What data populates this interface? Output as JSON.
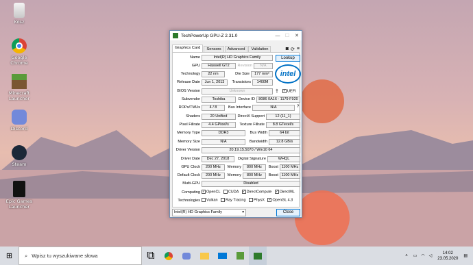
{
  "desktop_icons": [
    {
      "label": "Kosz",
      "icon": "recycle-bin-icon"
    },
    {
      "label": "Google Chrome",
      "icon": "chrome-icon"
    },
    {
      "label": "Minecraft Launcher",
      "icon": "minecraft-icon"
    },
    {
      "label": "Discord",
      "icon": "discord-icon"
    },
    {
      "label": "Steam",
      "icon": "steam-icon"
    },
    {
      "label": "Epic Games Launcher",
      "icon": "epic-games-icon"
    }
  ],
  "window": {
    "title": "TechPowerUp GPU-Z 2.31.0",
    "tabs": [
      "Graphics Card",
      "Sensors",
      "Advanced",
      "Validation"
    ],
    "lookup": "Lookup",
    "close": "Close",
    "gpu_select": "Intel(R) HD Graphics Family",
    "logo": "intel",
    "fields": {
      "name_l": "Name",
      "name": "Intel(R) HD Graphics Family",
      "gpu_l": "GPU",
      "gpu": "Haswell GT2",
      "rev_l": "Revision",
      "rev": "N/A",
      "tech_l": "Technology",
      "tech": "22 nm",
      "die_l": "Die Size",
      "die": "177 mm²",
      "rel_l": "Release Date",
      "rel": "Jun 1, 2013",
      "trans_l": "Transistors",
      "trans": "1400M",
      "bios_l": "BIOS Version",
      "bios": "Unknown",
      "uefi": "UEFI",
      "sub_l": "Subvendor",
      "sub": "Toshiba",
      "dev_l": "Device ID",
      "dev": "8086 0A16 - 1179 F920",
      "rops_l": "ROPs/TMUs",
      "rops": "4 / 8",
      "bus_l": "Bus Interface",
      "bus": "N/A",
      "q": "?",
      "shad_l": "Shaders",
      "shad": "20 Unified",
      "dx_l": "DirectX Support",
      "dx": "12 (11_1)",
      "pix_l": "Pixel Fillrate",
      "pix": "4.4 GPixel/s",
      "tex_l": "Texture Fillrate",
      "tex": "8.8 GTexel/s",
      "mt_l": "Memory Type",
      "mt": "DDR3",
      "bw_l": "Bus Width",
      "bw": "64 bit",
      "ms_l": "Memory Size",
      "ms": "N/A",
      "band_l": "Bandwidth",
      "band": "12.8 GB/s",
      "drv_l": "Driver Version",
      "drv": "20.19.15.5070 / Win10 64",
      "dd_l": "Driver Date",
      "dd": "Dec 27, 2018",
      "sig_l": "Digital Signature",
      "sig": "WHQL",
      "gc_l": "GPU Clock",
      "gc": "200 MHz",
      "mem1_l": "Memory",
      "mem1": "800 MHz",
      "boost1_l": "Boost",
      "boost1": "1100 MHz",
      "dc_l": "Default Clock",
      "dc": "200 MHz",
      "mem2_l": "Memory",
      "mem2": "800 MHz",
      "boost2_l": "Boost",
      "boost2": "1100 MHz",
      "mg_l": "Multi-GPU",
      "mg": "Disabled",
      "comp_l": "Computing",
      "opencl": "OpenCL",
      "cuda": "CUDA",
      "dcomp": "DirectCompute",
      "dml": "DirectML",
      "techs_l": "Technologies",
      "vulkan": "Vulkan",
      "rt": "Ray Tracing",
      "physx": "PhysX",
      "ogl": "OpenGL 4.3"
    }
  },
  "taskbar": {
    "search_placeholder": "Wpisz tu wyszukiwane słowa",
    "time": "14:02",
    "date": "23.05.2020"
  }
}
